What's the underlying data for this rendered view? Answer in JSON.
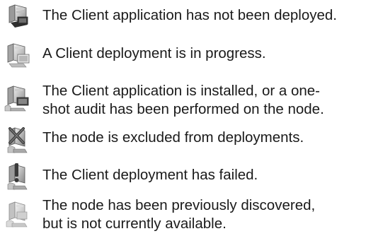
{
  "legend": {
    "items": [
      {
        "icon": "computer-not-deployed-icon",
        "lines": [
          "The Client application has not been deployed."
        ]
      },
      {
        "icon": "computer-deployment-in-progress-icon",
        "lines": [
          "A Client deployment is in progress."
        ]
      },
      {
        "icon": "computer-client-installed-icon",
        "lines": [
          "The Client application is installed, or a one-",
          "shot audit has been performed on the node."
        ]
      },
      {
        "icon": "computer-excluded-icon",
        "lines": [
          "The node is excluded from deployments."
        ]
      },
      {
        "icon": "computer-deployment-failed-icon",
        "lines": [
          "The Client deployment has failed."
        ]
      },
      {
        "icon": "computer-unavailable-icon",
        "lines": [
          "The node has been previously discovered,",
          "but is not currently available."
        ]
      }
    ]
  }
}
